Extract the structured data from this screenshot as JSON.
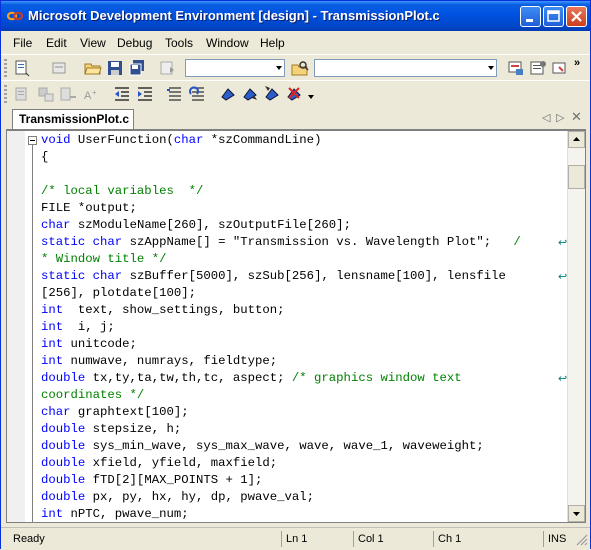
{
  "window": {
    "title": "Microsoft Development Environment [design] - TransmissionPlot.c",
    "controls": [
      "minimize",
      "maximize",
      "close"
    ]
  },
  "menu": [
    "File",
    "Edit",
    "View",
    "Debug",
    "Tools",
    "Window",
    "Help"
  ],
  "toolbar1": {
    "icons": [
      "new-project-icon",
      "add-item-icon",
      "open-folder-icon",
      "save-icon",
      "save-all-icon",
      "redo-icon",
      "find-in-files-icon",
      "solution-explorer-icon",
      "properties-icon",
      "toolbox-icon"
    ],
    "combo1_value": "",
    "combo2_value": ""
  },
  "toolbar2": {
    "icons": [
      "member-list-icon",
      "parameter-info-icon",
      "quick-info-icon",
      "complete-word-icon",
      "decrease-indent-icon",
      "increase-indent-icon",
      "comment-icon",
      "uncomment-icon",
      "toggle-bookmark-icon",
      "next-bookmark-icon",
      "previous-bookmark-icon",
      "clear-bookmarks-icon"
    ]
  },
  "tab": {
    "label": "TransmissionPlot.c"
  },
  "code_lines": [
    [
      [
        "kw",
        "void"
      ],
      [
        "t",
        " UserFunction("
      ],
      [
        "kw",
        "char"
      ],
      [
        "t",
        " *szCommandLine)"
      ]
    ],
    [
      [
        "t",
        "{"
      ]
    ],
    [
      [
        "t",
        ""
      ]
    ],
    [
      [
        "cm",
        "/* local variables  */"
      ]
    ],
    [
      [
        "t",
        "FILE *output;"
      ]
    ],
    [
      [
        "kw",
        "char"
      ],
      [
        "t",
        " szModuleName[260], szOutputFile[260];"
      ]
    ],
    [
      [
        "kw",
        "static"
      ],
      [
        "t",
        " "
      ],
      [
        "kw",
        "char"
      ],
      [
        "t",
        " szAppName[] = \"Transmission vs. Wavelength Plot\";   "
      ],
      [
        "cm",
        "/"
      ]
    ],
    [
      [
        "cm",
        "* Window title */"
      ]
    ],
    [
      [
        "kw",
        "static"
      ],
      [
        "t",
        " "
      ],
      [
        "kw",
        "char"
      ],
      [
        "t",
        " szBuffer[5000], szSub[256], lensname[100], lensfile"
      ]
    ],
    [
      [
        "t",
        "[256], plotdate[100];"
      ]
    ],
    [
      [
        "kw",
        "int"
      ],
      [
        "t",
        "  text, show_settings, button;"
      ]
    ],
    [
      [
        "kw",
        "int"
      ],
      [
        "t",
        "  i, j;"
      ]
    ],
    [
      [
        "kw",
        "int"
      ],
      [
        "t",
        " unitcode;"
      ]
    ],
    [
      [
        "kw",
        "int"
      ],
      [
        "t",
        " numwave, numrays, fieldtype;"
      ]
    ],
    [
      [
        "kw",
        "double"
      ],
      [
        "t",
        " tx,ty,ta,tw,th,tc, aspect; "
      ],
      [
        "cm",
        "/* graphics window text"
      ]
    ],
    [
      [
        "cm",
        "coordinates */"
      ]
    ],
    [
      [
        "kw",
        "char"
      ],
      [
        "t",
        " graphtext[100];"
      ]
    ],
    [
      [
        "kw",
        "double"
      ],
      [
        "t",
        " stepsize, h;"
      ]
    ],
    [
      [
        "kw",
        "double"
      ],
      [
        "t",
        " sys_min_wave, sys_max_wave, wave, wave_1, waveweight;"
      ]
    ],
    [
      [
        "kw",
        "double"
      ],
      [
        "t",
        " xfield, yfield, maxfield;"
      ]
    ],
    [
      [
        "kw",
        "double"
      ],
      [
        "t",
        " fTD[2][MAX_POINTS + 1];"
      ]
    ],
    [
      [
        "kw",
        "double"
      ],
      [
        "t",
        " px, py, hx, hy, dp, pwave_val;"
      ]
    ],
    [
      [
        "kw",
        "int"
      ],
      [
        "t",
        " nPTC, pwave_num;"
      ]
    ]
  ],
  "wrap_rows": [
    6,
    8,
    14
  ],
  "status": {
    "ready": "Ready",
    "line": "Ln 1",
    "col": "Col 1",
    "ch": "Ch 1",
    "ins": "INS"
  },
  "colors": {
    "keyword": "#0000ff",
    "comment": "#008000",
    "title_bar": "#0054e3"
  }
}
